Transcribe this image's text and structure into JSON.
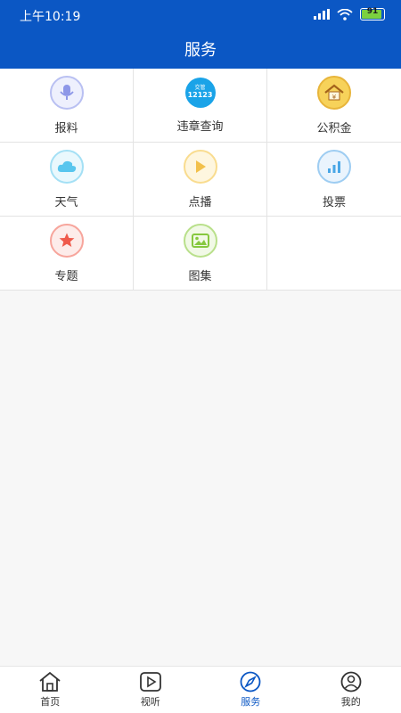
{
  "status_bar": {
    "time": "上午10:19",
    "battery": "91",
    "battery_level": 0.91
  },
  "header": {
    "title": "服务"
  },
  "services": [
    {
      "label": "报料",
      "icon": "microphone-icon",
      "color": "#8d97e8"
    },
    {
      "label": "违章查询",
      "icon": "traffic-12123-icon",
      "color": "#1aa3e8",
      "badge_top": "交管",
      "badge_num": "12123"
    },
    {
      "label": "公积金",
      "icon": "house-fund-icon",
      "color": "#e0a21e"
    },
    {
      "label": "天气",
      "icon": "cloud-icon",
      "color": "#58c6ee"
    },
    {
      "label": "点播",
      "icon": "play-icon",
      "color": "#f2c04b"
    },
    {
      "label": "投票",
      "icon": "bar-chart-icon",
      "color": "#4aa7e6"
    },
    {
      "label": "专题",
      "icon": "star-icon",
      "color": "#ef5a4c"
    },
    {
      "label": "图集",
      "icon": "image-icon",
      "color": "#86c83f"
    }
  ],
  "bottom_nav": [
    {
      "label": "首页",
      "icon": "home-icon"
    },
    {
      "label": "视听",
      "icon": "video-play-icon"
    },
    {
      "label": "服务",
      "icon": "compass-icon",
      "active": true
    },
    {
      "label": "我的",
      "icon": "user-icon"
    }
  ],
  "colors": {
    "primary": "#0b57c4",
    "background": "#f7f7f7"
  }
}
